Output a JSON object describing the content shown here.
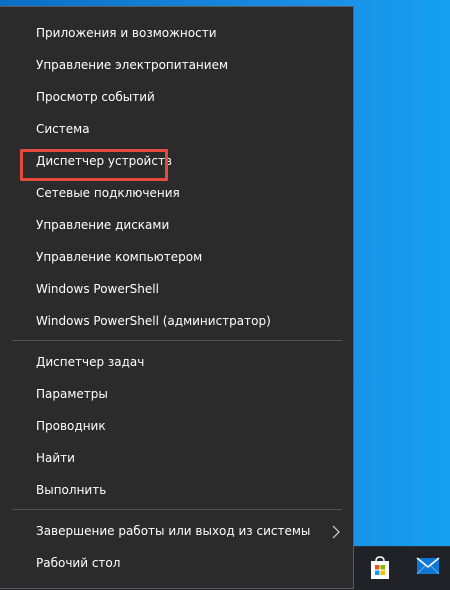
{
  "menu": {
    "items": [
      {
        "label": "Приложения и возможности"
      },
      {
        "label": "Управление электропитанием"
      },
      {
        "label": "Просмотр событий"
      },
      {
        "label": "Система"
      },
      {
        "label": "Диспетчер устройств"
      },
      {
        "label": "Сетевые подключения"
      },
      {
        "label": "Управление дисками"
      },
      {
        "label": "Управление компьютером"
      },
      {
        "label": "Windows PowerShell"
      },
      {
        "label": "Windows PowerShell (администратор)"
      },
      {
        "label": "Диспетчер задач"
      },
      {
        "label": "Параметры"
      },
      {
        "label": "Проводник"
      },
      {
        "label": "Найти"
      },
      {
        "label": "Выполнить"
      },
      {
        "label": "Завершение работы или выход из системы"
      },
      {
        "label": "Рабочий стол"
      }
    ]
  },
  "colors": {
    "menu_background": "#2b2b2b",
    "highlight_border": "#e44b3e",
    "desktop": "#0a7fd4",
    "taskbar": "#1f2226"
  },
  "icons": [
    "chevron-right-icon",
    "store-icon",
    "mail-icon"
  ]
}
